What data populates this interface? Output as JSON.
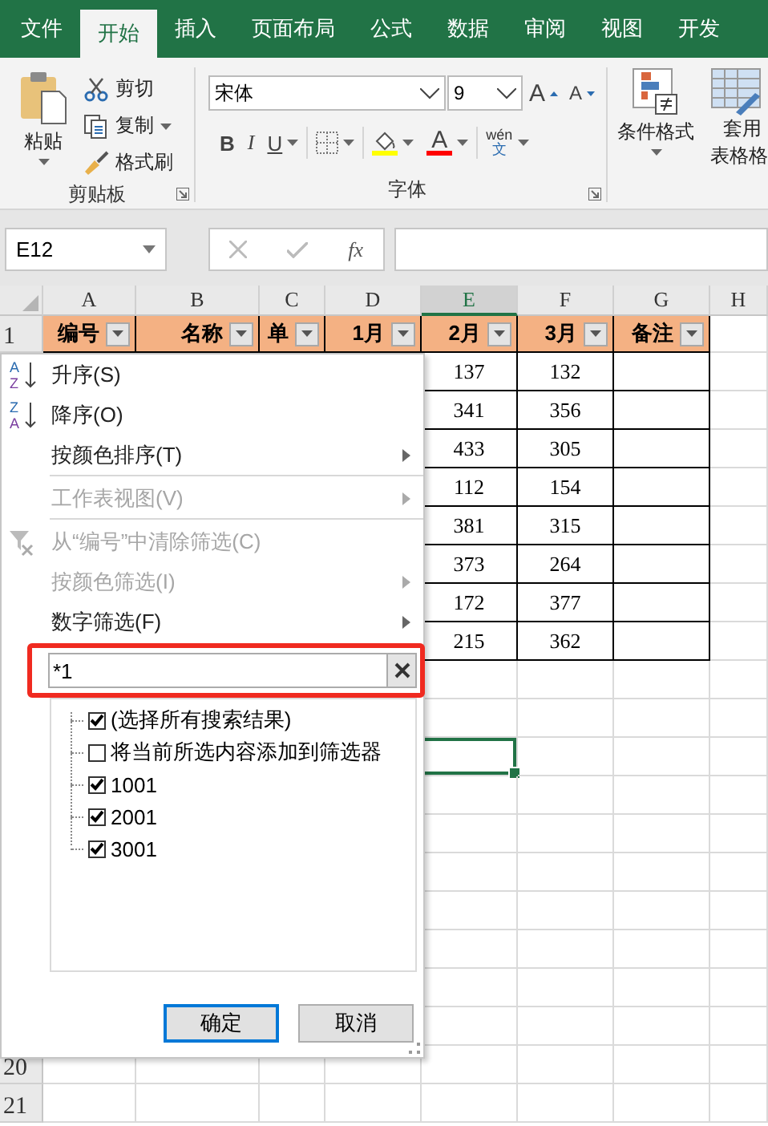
{
  "ribbon_tabs": [
    {
      "label": "文件",
      "selected": false
    },
    {
      "label": "开始",
      "selected": true
    },
    {
      "label": "插入",
      "selected": false
    },
    {
      "label": "页面布局",
      "selected": false
    },
    {
      "label": "公式",
      "selected": false
    },
    {
      "label": "数据",
      "selected": false
    },
    {
      "label": "审阅",
      "selected": false
    },
    {
      "label": "视图",
      "selected": false
    },
    {
      "label": "开发",
      "selected": false
    }
  ],
  "clipboard": {
    "paste": "粘贴",
    "cut": "剪切",
    "copy": "复制",
    "format_painter": "格式刷",
    "group_label": "剪贴板"
  },
  "font": {
    "font_name": "宋体",
    "font_size": "9",
    "grow_letter": "A",
    "shrink_letter": "A",
    "bold": "B",
    "italic": "I",
    "underline": "U",
    "font_color_letter": "A",
    "phonetic_top": "wén",
    "phonetic_bottom": "文",
    "group_label": "字体"
  },
  "styles": {
    "conditional_format": "条件格式",
    "table_format_top": "套用",
    "table_format_bottom": "表格格"
  },
  "formula_bar": {
    "name_box": "E12",
    "function_label": "fx"
  },
  "columns": [
    {
      "label": "A",
      "selected": false
    },
    {
      "label": "B",
      "selected": false
    },
    {
      "label": "C",
      "selected": false
    },
    {
      "label": "D",
      "selected": false
    },
    {
      "label": "E",
      "selected": true
    },
    {
      "label": "F",
      "selected": false
    },
    {
      "label": "G",
      "selected": false
    },
    {
      "label": "H",
      "selected": false
    }
  ],
  "header_row": {
    "number": "1",
    "cells": [
      "编号",
      "名称",
      "单",
      "1月",
      "2月",
      "3月",
      "备注"
    ]
  },
  "rows": [
    {
      "values": [
        "137",
        "132"
      ],
      "selected": false
    },
    {
      "values": [
        "341",
        "356"
      ],
      "selected": false
    },
    {
      "values": [
        "433",
        "305"
      ],
      "selected": false
    },
    {
      "values": [
        "112",
        "154"
      ],
      "selected": false
    },
    {
      "values": [
        "381",
        "315"
      ],
      "selected": false
    },
    {
      "values": [
        "373",
        "264"
      ],
      "selected": false
    },
    {
      "values": [
        "172",
        "377"
      ],
      "selected": false
    },
    {
      "values": [
        "215",
        "362"
      ],
      "selected": false
    },
    {
      "selected": false
    },
    {
      "selected": false
    },
    {
      "selected": true
    },
    {
      "selected": false
    },
    {
      "selected": false
    },
    {
      "selected": false
    },
    {
      "selected": false
    },
    {
      "selected": false
    },
    {
      "selected": false
    },
    {
      "selected": false
    },
    {
      "number": "20",
      "selected": false
    },
    {
      "number": "21",
      "selected": false
    }
  ],
  "filter_menu": {
    "items": [
      {
        "kind": "sort-ascending",
        "label": "升序(S)",
        "icon_letters": [
          "A",
          "Z"
        ],
        "disabled": false,
        "submenu": false
      },
      {
        "kind": "sort-descending",
        "label": "降序(O)",
        "icon_letters": [
          "Z",
          "A"
        ],
        "disabled": false,
        "submenu": false
      },
      {
        "kind": "plain",
        "label": "按颜色排序(T)",
        "disabled": false,
        "submenu": true
      },
      {
        "kind": "separator"
      },
      {
        "kind": "plain",
        "label": "工作表视图(V)",
        "disabled": true,
        "submenu": true
      },
      {
        "kind": "separator"
      },
      {
        "kind": "clear-filter",
        "label": "从“编号”中清除筛选(C)",
        "disabled": true,
        "submenu": false
      },
      {
        "kind": "plain",
        "label": "按颜色筛选(I)",
        "disabled": true,
        "submenu": true
      },
      {
        "kind": "plain",
        "label": "数字筛选(F)",
        "disabled": false,
        "submenu": true
      }
    ],
    "search": {
      "value": "*1",
      "highlighted": true
    },
    "checklist": [
      {
        "label": "(选择所有搜索结果)",
        "checked": true
      },
      {
        "label": "将当前所选内容添加到筛选器",
        "checked": false
      },
      {
        "label": "1001",
        "checked": true
      },
      {
        "label": "2001",
        "checked": true
      },
      {
        "label": "3001",
        "checked": true
      }
    ],
    "buttons": [
      {
        "label": "确定",
        "focused": true
      },
      {
        "label": "取消",
        "focused": false
      }
    ]
  }
}
